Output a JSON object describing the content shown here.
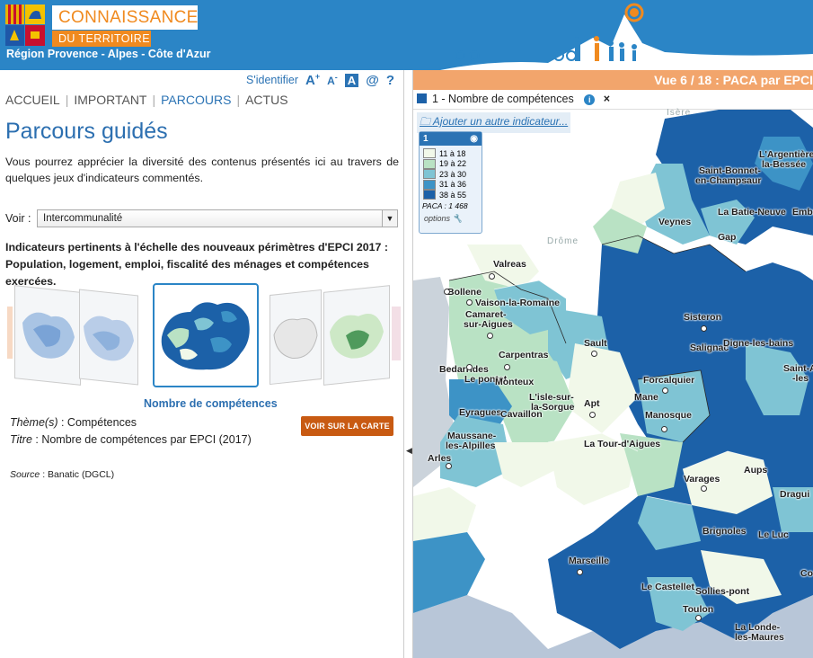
{
  "header": {
    "brand_line1": "CONNAISSANCE",
    "brand_line2": "DU TERRITOIRE",
    "region": "Région Provence - Alpes - Côte d'Azur",
    "colors": {
      "primary": "#2b85c6",
      "accent": "#f08a1f"
    }
  },
  "toolbar": {
    "login": "S'identifier",
    "font_plus": "A",
    "font_minus": "A",
    "contrast": "A",
    "contact": "@",
    "help": "?"
  },
  "nav": {
    "items": [
      {
        "label": "ACCUEIL"
      },
      {
        "label": "IMPORTANT"
      },
      {
        "label": "PARCOURS"
      },
      {
        "label": "ACTUS"
      }
    ],
    "active": "PARCOURS"
  },
  "main": {
    "title": "Parcours guidés",
    "intro": "Vous pourrez apprécier la diversité des contenus présentés ici au travers de quelques jeux d'indicateurs commentés.",
    "voir_label": "Voir :",
    "voir_value": "Intercommunalité",
    "indicators_text": "Indicateurs pertinents à l'échelle des nouveaux périmètres d'EPCI 2017 : Population, logement, emploi, fiscalité des ménages et compétences exercées.",
    "thumb_caption": "Nombre de compétences",
    "theme_label": "Thème(s)",
    "theme_value": ": Compétences",
    "titre_label": "Titre",
    "titre_value": ": Nombre de compétences par EPCI (2017)",
    "voir_carte": "VOIR SUR LA CARTE",
    "source_label": "Source",
    "source_value": ": Banatic (DGCL)"
  },
  "map": {
    "view_title": "Vue 6 / 18 : PACA par EPCI",
    "indicator_label": "1 - Nombre de compétences",
    "add_indicator": "Ajouter un autre indicateur...",
    "legend": {
      "id": "1",
      "classes": [
        {
          "label": "11 à 18",
          "color": "#f1f8e9"
        },
        {
          "label": "19 à 22",
          "color": "#b9e2c4"
        },
        {
          "label": "23 à 30",
          "color": "#7fc4d4"
        },
        {
          "label": "31 à 36",
          "color": "#3d93c6"
        },
        {
          "label": "38 à 55",
          "color": "#1c61a8"
        }
      ],
      "total": "PACA : 1 468",
      "options": "options"
    },
    "rivers": [
      {
        "name": "Isère"
      },
      {
        "name": "Drôme"
      }
    ],
    "places": [
      {
        "name": "L'Argentière-"
      },
      {
        "name": "la-Bessée"
      },
      {
        "name": "Saint-Bonnet-"
      },
      {
        "name": "en-Champsaur"
      },
      {
        "name": "Veynes"
      },
      {
        "name": "La Batie-Neuve"
      },
      {
        "name": "Embr"
      },
      {
        "name": "Gap"
      },
      {
        "name": "Valreas"
      },
      {
        "name": "Bollene"
      },
      {
        "name": "Vaison-la-Romaine"
      },
      {
        "name": "Camaret-"
      },
      {
        "name": "sur-Aigues"
      },
      {
        "name": "Sisteron"
      },
      {
        "name": "Sault"
      },
      {
        "name": "Carpentras"
      },
      {
        "name": "Salignac"
      },
      {
        "name": "Digne-les-bains"
      },
      {
        "name": "Bedarrides"
      },
      {
        "name": "Le pontet"
      },
      {
        "name": "Monteux"
      },
      {
        "name": "Saint-A"
      },
      {
        "name": "-les"
      },
      {
        "name": "Forcalquier"
      },
      {
        "name": "L'isle-sur-"
      },
      {
        "name": "la-Sorgue"
      },
      {
        "name": "Apt"
      },
      {
        "name": "Mane"
      },
      {
        "name": "Eyragues"
      },
      {
        "name": "Cavaillon"
      },
      {
        "name": "Manosque"
      },
      {
        "name": "Maussane-"
      },
      {
        "name": "les-Alpilles"
      },
      {
        "name": "La Tour-d'Aigues"
      },
      {
        "name": "Arles"
      },
      {
        "name": "Aups"
      },
      {
        "name": "Varages"
      },
      {
        "name": "Dragui"
      },
      {
        "name": "Brignoles"
      },
      {
        "name": "Le Luc"
      },
      {
        "name": "Marseille"
      },
      {
        "name": "Co"
      },
      {
        "name": "Le Castellet"
      },
      {
        "name": "Sollies-pont"
      },
      {
        "name": "Toulon"
      },
      {
        "name": "La Londe-"
      },
      {
        "name": "les-Maures"
      }
    ]
  }
}
